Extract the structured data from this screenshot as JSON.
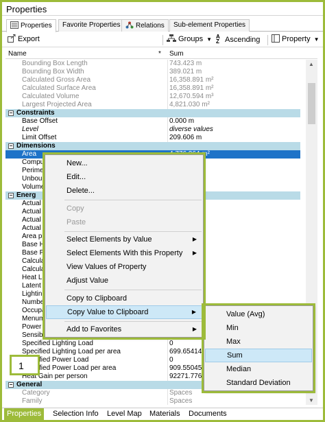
{
  "window": {
    "title": "Properties"
  },
  "tabs": [
    {
      "label": "Properties"
    },
    {
      "label": "Favorite Properties"
    },
    {
      "label": "Relations"
    },
    {
      "label": "Sub-element Properties"
    }
  ],
  "toolbar": {
    "export_label": "Export",
    "groups_label": "Groups",
    "sort_label": "Ascending",
    "property_label": "Property"
  },
  "columns": {
    "name": "Name",
    "asterisk": "*",
    "sum": "Sum"
  },
  "rows": [
    {
      "name": "Bounding Box Length",
      "value": "743.423 m"
    },
    {
      "name": "Bounding Box Width",
      "value": "389.021 m"
    },
    {
      "name": "Calculated Gross Area",
      "value": "16,358.891 m²"
    },
    {
      "name": "Calculated Surface Area",
      "value": "16,358.891 m²"
    },
    {
      "name": "Calculated Volume",
      "value": "12,670.594 m³"
    },
    {
      "name": "Largest Projected Area",
      "value": "4,821.030 m²"
    },
    {
      "name": "Constraints",
      "value": ""
    },
    {
      "name": "Base Offset",
      "value": "0.000 m"
    },
    {
      "name": "Level",
      "value": "diverse values"
    },
    {
      "name": "Limit Offset",
      "value": "209.606 m"
    },
    {
      "name": "Dimensions",
      "value": ""
    },
    {
      "name": "Area",
      "value": "4,776.264 m²"
    },
    {
      "name": "Compu",
      "value": ""
    },
    {
      "name": "Perime",
      "value": ""
    },
    {
      "name": "Unbou",
      "value": ""
    },
    {
      "name": "Volume",
      "value": "m³"
    },
    {
      "name": "Energ",
      "value": ""
    },
    {
      "name": "Actual",
      "value": ""
    },
    {
      "name": "Actual",
      "value": ""
    },
    {
      "name": "Actual",
      "value": ""
    },
    {
      "name": "Actual",
      "value": ""
    },
    {
      "name": "Area p",
      "value": "m²"
    },
    {
      "name": "Base H",
      "value": ""
    },
    {
      "name": "Base P",
      "value": ""
    },
    {
      "name": "Calcula",
      "value": ""
    },
    {
      "name": "Calcula",
      "value": ""
    },
    {
      "name": "Heat Lo",
      "value": ""
    },
    {
      "name": "Latent",
      "value": "871"
    },
    {
      "name": "Lightin",
      "value": ""
    },
    {
      "name": "Numbe",
      "value": ""
    },
    {
      "name": "Occupa",
      "value": ""
    },
    {
      "name": "Menum",
      "value": ""
    },
    {
      "name": "Power",
      "value": ""
    },
    {
      "name": "Sensibl",
      "value": ""
    },
    {
      "name": "Specified Lighting Load",
      "value": "0"
    },
    {
      "name": "Specified Lighting Load per area",
      "value": "699.65414"
    },
    {
      "name": "Specified Power Load",
      "value": "0"
    },
    {
      "name": "Specified Power Load per area",
      "value": "909.55045"
    },
    {
      "name": "Heat Gain per person",
      "value": "92271.776"
    },
    {
      "name": "General",
      "value": ""
    },
    {
      "name": "Category",
      "value": "Spaces"
    },
    {
      "name": "Family",
      "value": "Spaces"
    }
  ],
  "context_menu": {
    "items": [
      {
        "label": "New..."
      },
      {
        "label": "Edit..."
      },
      {
        "label": "Delete..."
      },
      {
        "label": "Copy"
      },
      {
        "label": "Paste"
      },
      {
        "label": "Select Elements by Value"
      },
      {
        "label": "Select Elements With this Property"
      },
      {
        "label": "View Values of Property"
      },
      {
        "label": "Adjust Value"
      },
      {
        "label": "Copy to Clipboard"
      },
      {
        "label": "Copy Value to Clipboard"
      },
      {
        "label": "Add to Favorites"
      }
    ]
  },
  "submenu": {
    "items": [
      {
        "label": "Value (Avg)"
      },
      {
        "label": "Min"
      },
      {
        "label": "Max"
      },
      {
        "label": "Sum"
      },
      {
        "label": "Median"
      },
      {
        "label": "Standard Deviation"
      }
    ]
  },
  "badge": {
    "number": "1"
  },
  "bottom_tabs": [
    {
      "label": "Properties"
    },
    {
      "label": "Selection Info"
    },
    {
      "label": "Level Map"
    },
    {
      "label": "Materials"
    },
    {
      "label": "Documents"
    }
  ],
  "colors": {
    "accent_green": "#9dbb3a",
    "group_header": "#b9dbe7",
    "selection_blue": "#1e73c8",
    "menu_highlight": "#cde8f7"
  }
}
